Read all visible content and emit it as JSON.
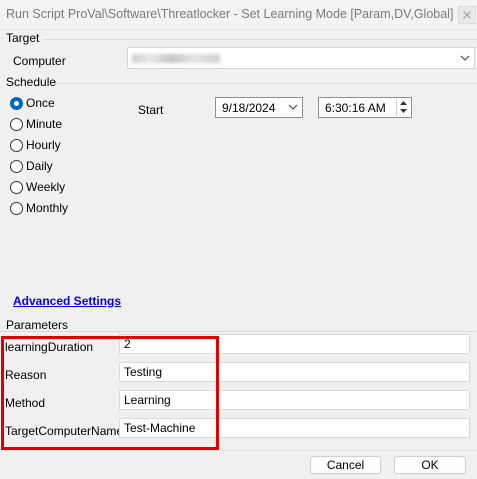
{
  "window": {
    "title": "Run Script ProVal\\Software\\Threatlocker - Set Learning Mode [Param,DV,Global]"
  },
  "target": {
    "section_label": "Target",
    "computer_label": "Computer"
  },
  "schedule": {
    "section_label": "Schedule",
    "options": [
      {
        "label": "Once",
        "checked": true
      },
      {
        "label": "Minute",
        "checked": false
      },
      {
        "label": "Hourly",
        "checked": false
      },
      {
        "label": "Daily",
        "checked": false
      },
      {
        "label": "Weekly",
        "checked": false
      },
      {
        "label": "Monthly",
        "checked": false
      }
    ],
    "start_label": "Start",
    "start_date": "9/18/2024",
    "start_time": "6:30:16 AM",
    "advanced_link": "Advanced Settings"
  },
  "parameters": {
    "section_label": "Parameters",
    "rows": [
      {
        "label": "learningDuration",
        "value": "2"
      },
      {
        "label": "Reason",
        "value": "Testing"
      },
      {
        "label": "Method",
        "value": "Learning"
      },
      {
        "label": "TargetComputerName",
        "value": "Test-Machine"
      }
    ],
    "highlight_color": "#e00000"
  },
  "buttons": {
    "cancel": "Cancel",
    "ok": "OK"
  },
  "colors": {
    "accent": "#0067c0",
    "link": "#0000ee"
  }
}
